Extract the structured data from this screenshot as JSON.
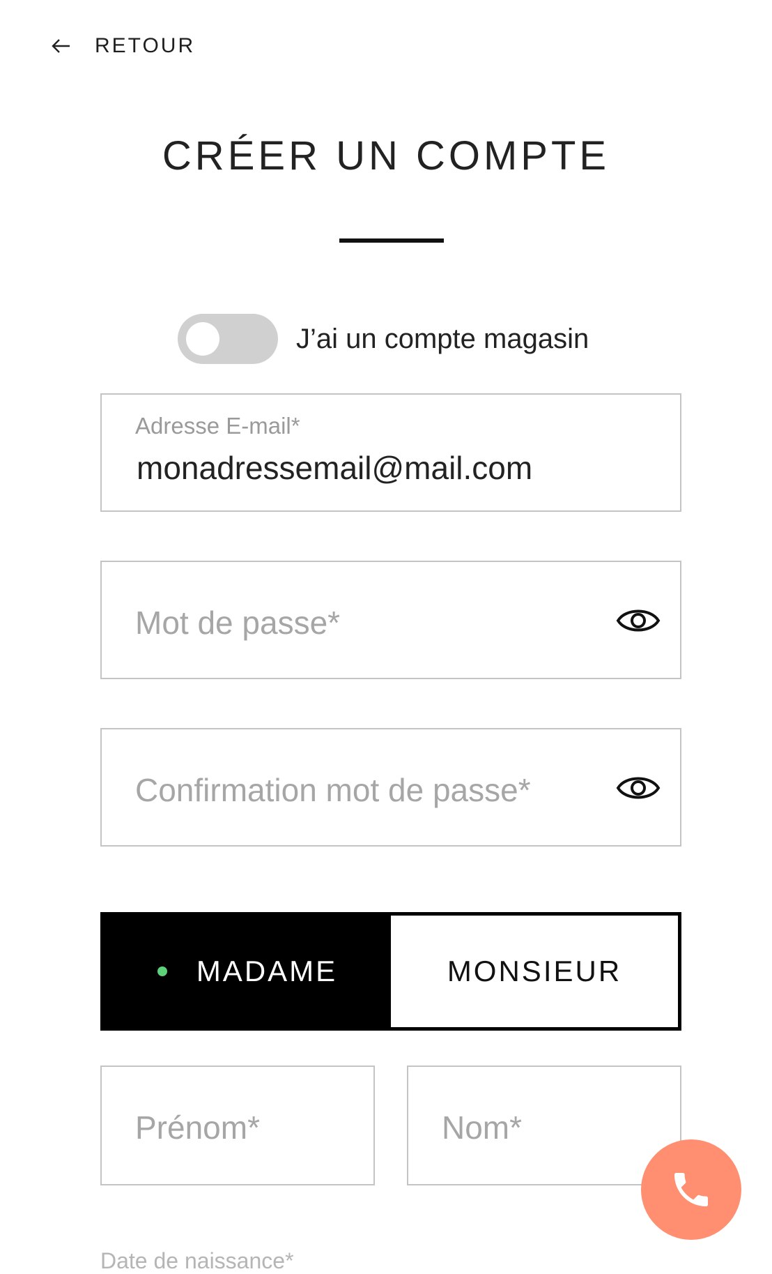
{
  "nav": {
    "back_label": "RETOUR"
  },
  "header": {
    "title": "CRÉER UN COMPTE"
  },
  "store_account": {
    "label": "J’ai un compte magasin",
    "enabled": false
  },
  "email": {
    "label": "Adresse E-mail*",
    "value": "monadressemail@mail.com"
  },
  "password": {
    "placeholder": "Mot de passe*"
  },
  "password_confirm": {
    "placeholder": "Confirmation mot de passe*"
  },
  "gender": {
    "options": [
      "MADAME",
      "MONSIEUR"
    ],
    "selected": "MADAME"
  },
  "first_name": {
    "placeholder": "Prénom*"
  },
  "last_name": {
    "placeholder": "Nom*"
  },
  "birth_date": {
    "label": "Date de naissance*"
  },
  "colors": {
    "accent_call": "#ff8f70",
    "selected_dot": "#5dd07a",
    "toggle_off": "#d0d0d0"
  },
  "icons": {
    "back": "arrow-left-icon",
    "eye": "eye-icon",
    "phone": "phone-icon"
  }
}
